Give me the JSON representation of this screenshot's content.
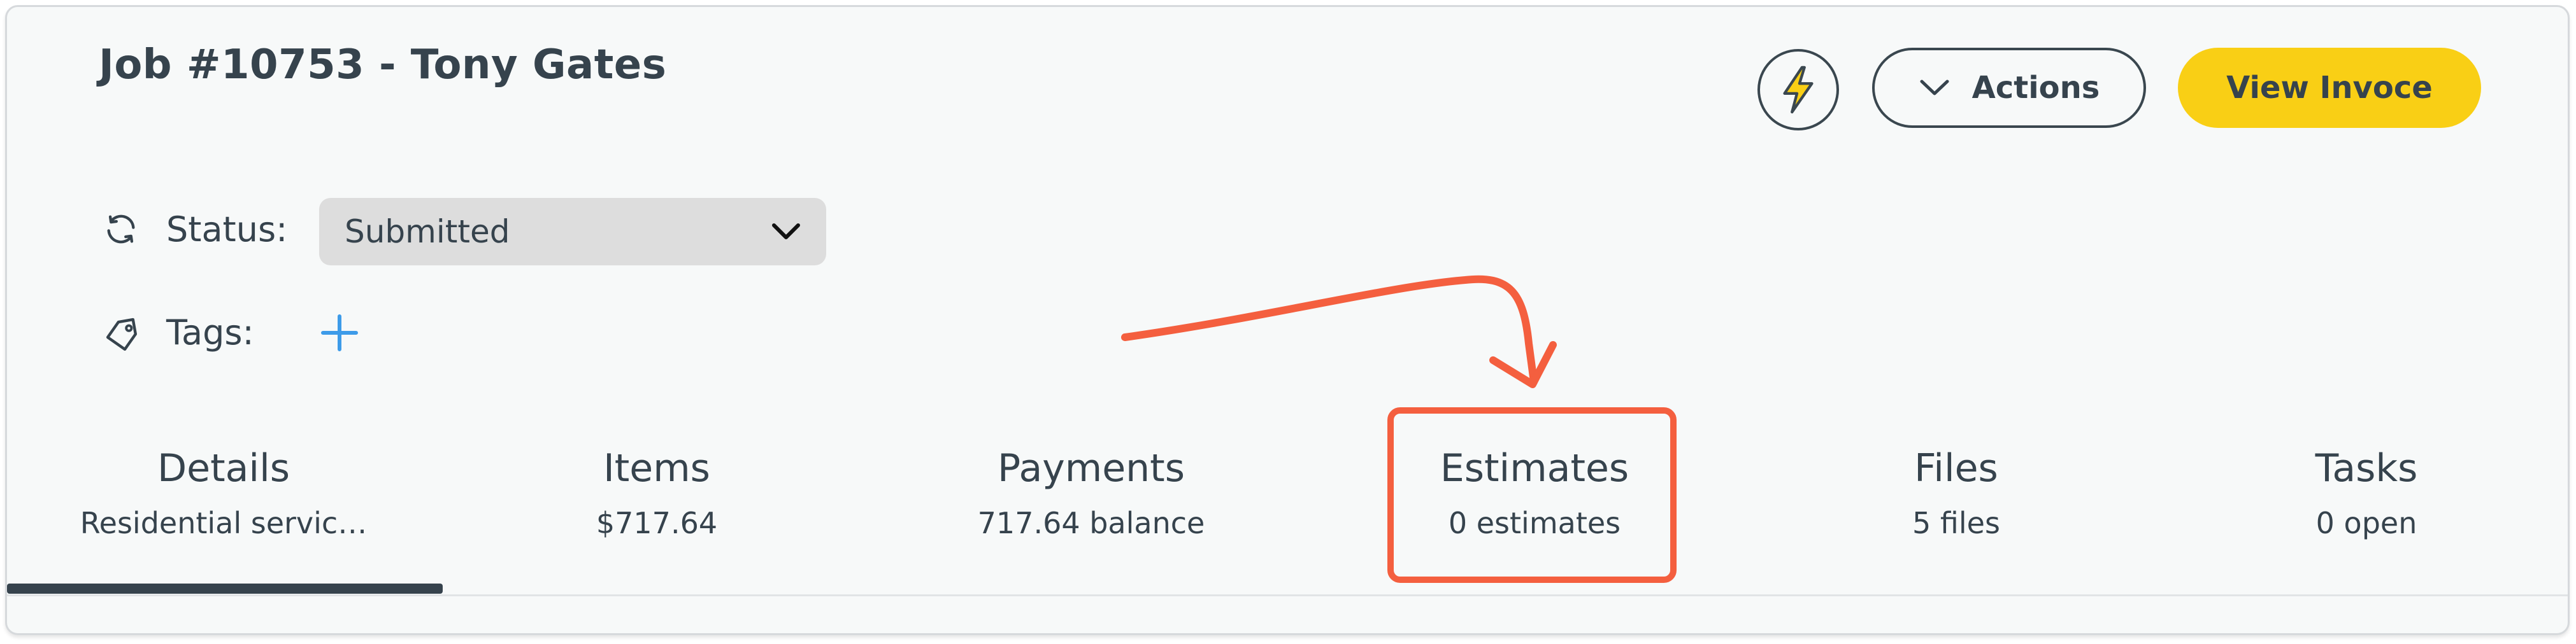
{
  "header": {
    "title": "Job #10753 - Tony Gates",
    "actions_label": "Actions",
    "view_invoice_label": "View Invoce"
  },
  "status": {
    "label": "Status:",
    "value": "Submitted"
  },
  "tags": {
    "label": "Tags:"
  },
  "tabs": [
    {
      "label": "Details",
      "sub": "Residential servic…"
    },
    {
      "label": "Items",
      "sub": "$717.64"
    },
    {
      "label": "Payments",
      "sub": "717.64 balance"
    },
    {
      "label": "Estimates",
      "sub": "0 estimates"
    },
    {
      "label": "Files",
      "sub": "5 files"
    },
    {
      "label": "Tasks",
      "sub": "0 open"
    }
  ],
  "active_tab_index": 0,
  "icons": {
    "automation": "lightning-bolt-icon",
    "actions": "chevron-down-icon",
    "status": "refresh-icon",
    "status_dropdown": "chevron-down-icon",
    "tags": "tag-icon",
    "add_tag": "plus-icon"
  },
  "colors": {
    "primary_text": "#36434d",
    "accent_yellow": "#f9cf15",
    "card_bg": "#f7f9f9",
    "select_bg": "#dddddd",
    "add_blue": "#3d9be9",
    "annotation_red": "#f45f3f"
  }
}
